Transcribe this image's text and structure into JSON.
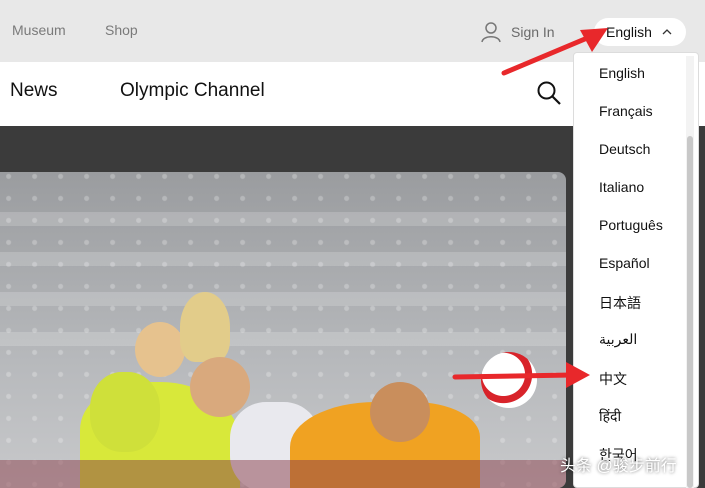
{
  "topbar": {
    "museum": "Museum",
    "shop": "Shop",
    "sign_in": "Sign In",
    "language_button": "English"
  },
  "mainnav": {
    "news": "News",
    "olympic_channel": "Olympic Channel"
  },
  "language_menu": {
    "items": [
      {
        "label": "English"
      },
      {
        "label": "Français"
      },
      {
        "label": "Deutsch"
      },
      {
        "label": "Italiano"
      },
      {
        "label": "Português"
      },
      {
        "label": "Español"
      },
      {
        "label": "日本語"
      },
      {
        "label": "العربية"
      },
      {
        "label": "中文"
      },
      {
        "label": "हिंदी"
      },
      {
        "label": "한국어"
      }
    ]
  },
  "watermark": "头条 @骏步前行",
  "icons": {
    "user": "user-icon",
    "chevron": "chevron-up-icon",
    "search": "search-icon"
  },
  "colors": {
    "topbar_bg": "#e8e8e8",
    "arrow": "#e8282b",
    "ball_red": "#d8232a",
    "jersey_yellow": "#d8e83a",
    "jersey_orange": "#f0a222"
  }
}
